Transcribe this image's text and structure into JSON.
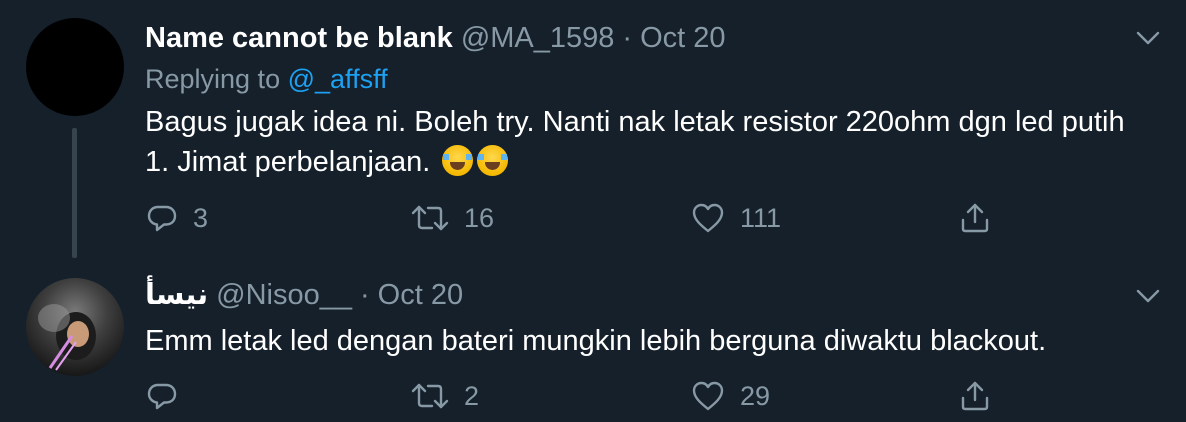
{
  "tweets": [
    {
      "name": "Name cannot be blank",
      "handle": "@MA_1598",
      "separator": "·",
      "date": "Oct 20",
      "replying_to_label": "Replying to",
      "replying_to_mention": "@_affsff",
      "text": "Bagus jugak idea ni. Boleh try. Nanti nak letak resistor 220ohm dgn led putih 1. Jimat perbelanjaan.",
      "emoji": [
        "face-with-tears-of-joy",
        "face-with-tears-of-joy"
      ],
      "reply_count": "3",
      "retweet_count": "16",
      "like_count": "111"
    },
    {
      "name": "نيسأ",
      "handle": "@Nisoo__",
      "separator": "·",
      "date": "Oct 20",
      "text": "Emm letak led dengan bateri mungkin lebih berguna diwaktu blackout.",
      "reply_count": "",
      "retweet_count": "2",
      "like_count": "29"
    }
  ],
  "icons": {
    "reply": "reply-icon",
    "retweet": "retweet-icon",
    "like": "heart-icon",
    "share": "share-icon",
    "menu": "chevron-down-icon"
  },
  "colors": {
    "background": "#15202b",
    "primary_text": "#ffffff",
    "secondary_text": "#8899a6",
    "accent": "#1da1f2",
    "thread_line": "#38444d"
  }
}
